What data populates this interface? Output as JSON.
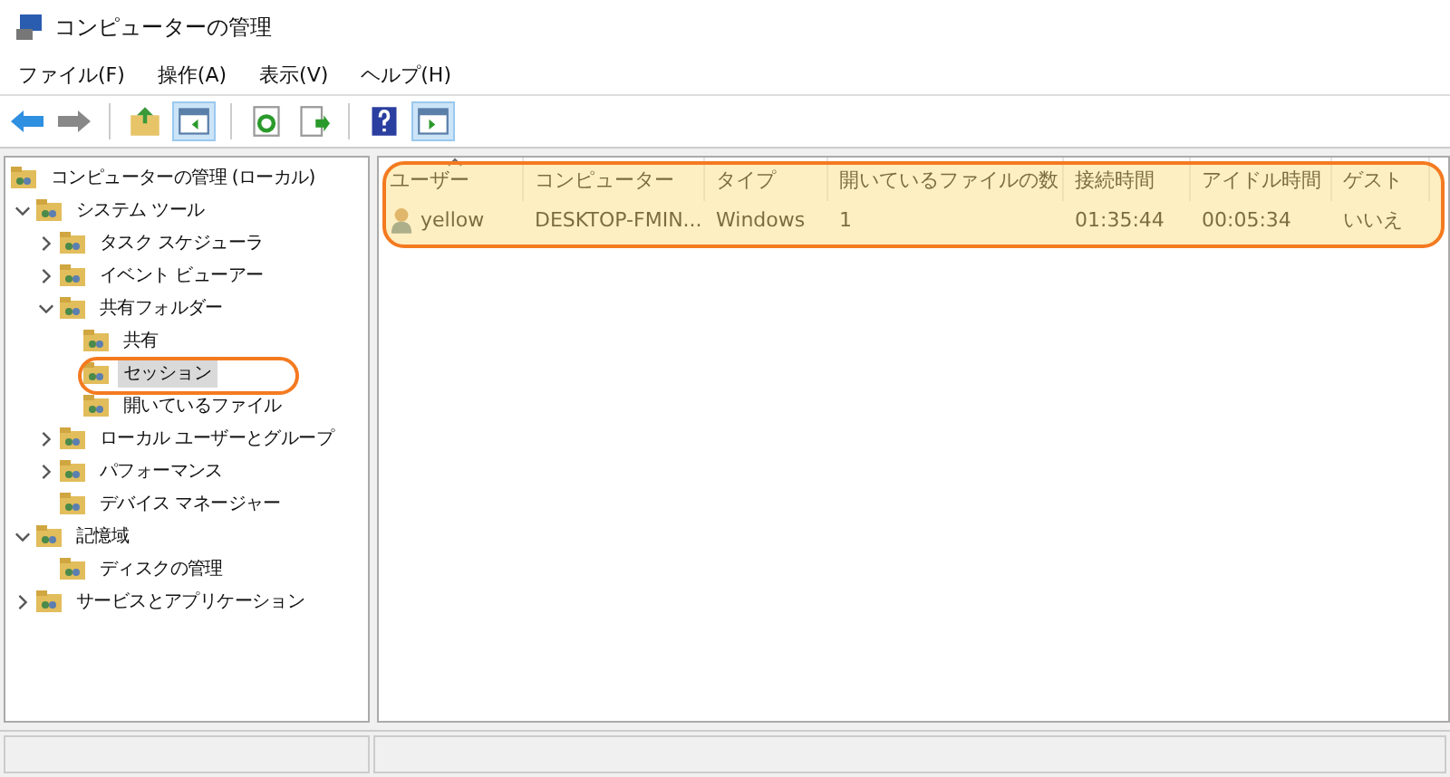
{
  "window": {
    "title": "コンピューターの管理"
  },
  "menu": [
    "ファイル(F)",
    "操作(A)",
    "表示(V)",
    "ヘルプ(H)"
  ],
  "tree": {
    "label": "コンピューターの管理 (ローカル)",
    "selected": false,
    "children": [
      {
        "label": "システム ツール",
        "expanded": true,
        "selected": false,
        "children": [
          {
            "label": "タスク スケジューラ",
            "expanded": false,
            "selected": false
          },
          {
            "label": "イベント ビューアー",
            "expanded": false,
            "selected": false
          },
          {
            "label": "共有フォルダー",
            "expanded": true,
            "selected": false,
            "children": [
              {
                "label": "共有",
                "selected": false
              },
              {
                "label": "セッション",
                "selected": true
              },
              {
                "label": "開いているファイル",
                "selected": false
              }
            ]
          },
          {
            "label": "ローカル ユーザーとグループ",
            "expanded": false,
            "selected": false
          },
          {
            "label": "パフォーマンス",
            "expanded": false,
            "selected": false
          },
          {
            "label": "デバイス マネージャー",
            "selected": false
          }
        ]
      },
      {
        "label": "記憶域",
        "expanded": true,
        "selected": false,
        "children": [
          {
            "label": "ディスクの管理",
            "selected": false
          }
        ]
      },
      {
        "label": "サービスとアプリケーション",
        "expanded": false,
        "selected": false
      }
    ]
  },
  "table": {
    "columns": [
      {
        "label": "ユーザー",
        "sorted": true
      },
      {
        "label": "コンピューター",
        "sorted": false
      },
      {
        "label": "タイプ",
        "sorted": false
      },
      {
        "label": "開いているファイルの数",
        "sorted": false
      },
      {
        "label": "接続時間",
        "sorted": false
      },
      {
        "label": "アイドル時間",
        "sorted": false
      },
      {
        "label": "ゲスト",
        "sorted": false
      }
    ],
    "rows": [
      [
        "yellow",
        "DESKTOP-FMIN...",
        "Windows",
        "1",
        "01:35:44",
        "00:05:34",
        "いいえ"
      ]
    ]
  }
}
